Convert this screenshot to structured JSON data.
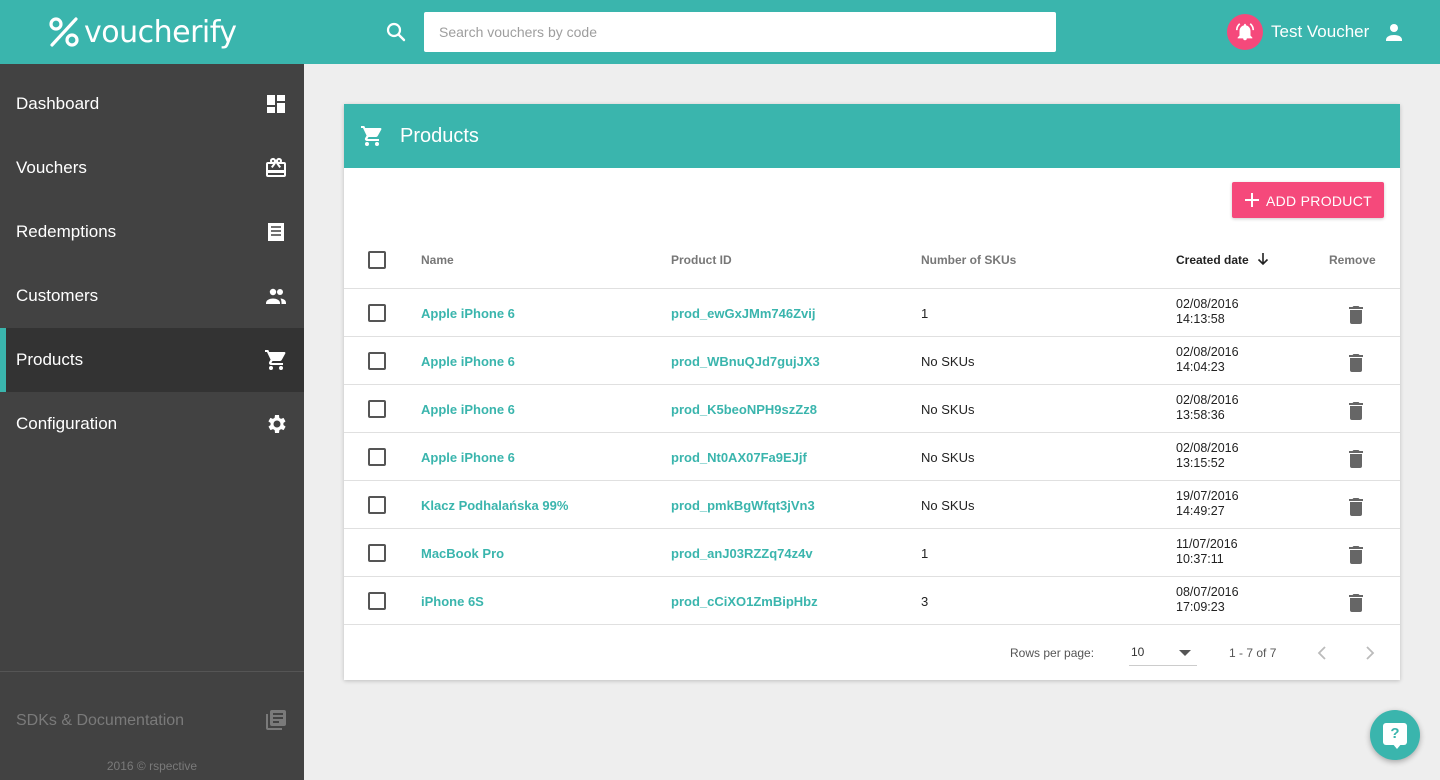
{
  "header": {
    "logo_text": "voucherify",
    "search_placeholder": "Search vouchers by code",
    "user_name": "Test Voucher"
  },
  "sidebar": {
    "items": [
      {
        "label": "Dashboard",
        "icon": "dashboard-icon"
      },
      {
        "label": "Vouchers",
        "icon": "gift-card-icon"
      },
      {
        "label": "Redemptions",
        "icon": "receipt-icon"
      },
      {
        "label": "Customers",
        "icon": "people-icon"
      },
      {
        "label": "Products",
        "icon": "cart-icon",
        "active": true
      },
      {
        "label": "Configuration",
        "icon": "gear-icon"
      }
    ],
    "sdk_label": "SDKs & Documentation",
    "copyright": "2016 © rspective"
  },
  "card": {
    "title": "Products",
    "add_button": "ADD PRODUCT",
    "columns": {
      "name": "Name",
      "product_id": "Product ID",
      "skus": "Number of SKUs",
      "created": "Created date",
      "remove": "Remove"
    },
    "rows": [
      {
        "name": "Apple iPhone 6",
        "id": "prod_ewGxJMm746Zvij",
        "skus": "1",
        "date": "02/08/2016",
        "time": "14:13:58"
      },
      {
        "name": "Apple iPhone 6",
        "id": "prod_WBnuQJd7gujJX3",
        "skus": "No SKUs",
        "date": "02/08/2016",
        "time": "14:04:23"
      },
      {
        "name": "Apple iPhone 6",
        "id": "prod_K5beoNPH9szZz8",
        "skus": "No SKUs",
        "date": "02/08/2016",
        "time": "13:58:36"
      },
      {
        "name": "Apple iPhone 6",
        "id": "prod_Nt0AX07Fa9EJjf",
        "skus": "No SKUs",
        "date": "02/08/2016",
        "time": "13:15:52"
      },
      {
        "name": "Klacz Podhalańska 99%",
        "id": "prod_pmkBgWfqt3jVn3",
        "skus": "No SKUs",
        "date": "19/07/2016",
        "time": "14:49:27"
      },
      {
        "name": "MacBook Pro",
        "id": "prod_anJ03RZZq74z4v",
        "skus": "1",
        "date": "11/07/2016",
        "time": "10:37:11"
      },
      {
        "name": "iPhone 6S",
        "id": "prod_cCiXO1ZmBipHbz",
        "skus": "3",
        "date": "08/07/2016",
        "time": "17:09:23"
      }
    ],
    "pagination": {
      "rows_per_page_label": "Rows per page:",
      "rows_per_page": "10",
      "range": "1 - 7 of 7"
    }
  },
  "colors": {
    "brand": "#3ab5ad",
    "accent": "#f5497b",
    "sidebar": "#424242"
  }
}
